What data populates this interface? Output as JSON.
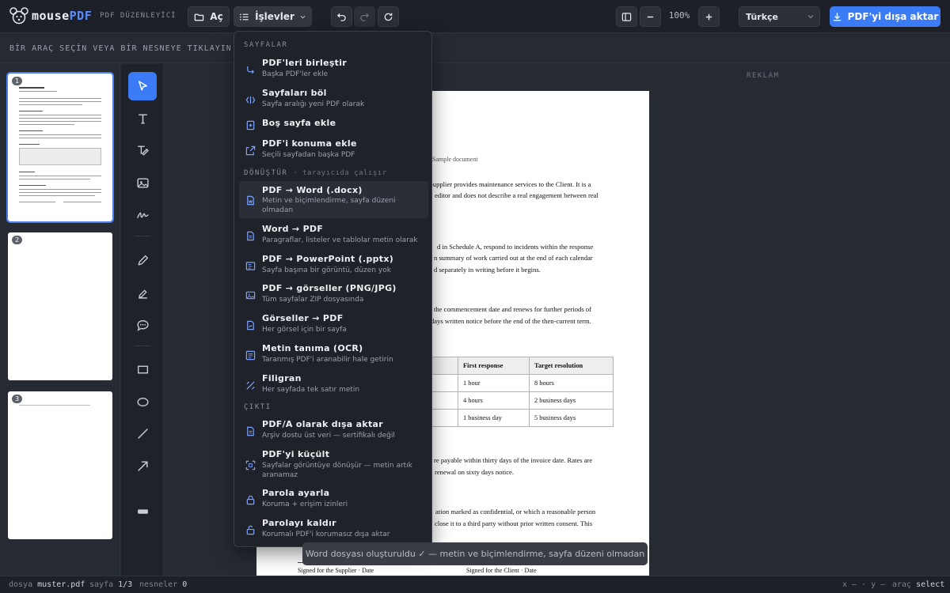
{
  "app": {
    "name_part1": "mouse",
    "name_part2": "PDF",
    "subtitle": "PDF DÜZENLEYİCİ",
    "logo_icon": "mouse-logo-icon"
  },
  "toolbar": {
    "open_label": "Aç",
    "functions_label": "İşlevler",
    "zoom": "100%",
    "language": "Türkçe",
    "export_label": "PDF'yi dışa aktar"
  },
  "hint": "BİR ARAÇ SEÇİN VEYA BİR NESNEYE TIKLAYIN — BAĞLA",
  "ad_label": "REKLAM",
  "thumbnails": [
    {
      "num": "1"
    },
    {
      "num": "2"
    },
    {
      "num": "3"
    }
  ],
  "tools": [
    "select-tool",
    "text-tool",
    "edit-text-tool",
    "image-tool",
    "signature-tool",
    "pencil-tool",
    "highlighter-tool",
    "comment-tool",
    "rectangle-tool",
    "ellipse-tool",
    "line-tool",
    "arrow-tool",
    "redact-tool"
  ],
  "menu": {
    "sections": {
      "pages": "SAYFALAR",
      "convert": "DÖNÜŞTÜR",
      "convert_note": "· tarayıcıda çalışır",
      "output": "ÇIKTI"
    },
    "items": [
      {
        "title": "PDF'leri birleştir",
        "desc": "Başka PDF'ler ekle",
        "icon": "merge-icon"
      },
      {
        "title": "Sayfaları böl",
        "desc": "Sayfa aralığı yeni PDF olarak",
        "icon": "split-icon"
      },
      {
        "title": "Boş sayfa ekle",
        "desc": "",
        "icon": "blank-page-icon"
      },
      {
        "title": "PDF'i konuma ekle",
        "desc": "Seçili sayfadan başka PDF",
        "icon": "insert-pdf-icon"
      },
      {
        "title": "PDF → Word (.docx)",
        "desc": "Metin ve biçimlendirme, sayfa düzeni olmadan",
        "icon": "word-doc-icon"
      },
      {
        "title": "Word → PDF",
        "desc": "Paragraflar, listeler ve tablolar metin olarak",
        "icon": "pdf-doc-icon"
      },
      {
        "title": "PDF → PowerPoint (.pptx)",
        "desc": "Sayfa başına bir görüntü, düzen yok",
        "icon": "slides-icon"
      },
      {
        "title": "PDF → görseller (PNG/JPG)",
        "desc": "Tüm sayfalar ZIP dosyasında",
        "icon": "image-export-icon"
      },
      {
        "title": "Görseller → PDF",
        "desc": "Her görsel için bir sayfa",
        "icon": "image-to-pdf-icon"
      },
      {
        "title": "Metin tanıma (OCR)",
        "desc": "Taranmış PDF'i aranabilir hale getirin",
        "icon": "ocr-icon"
      },
      {
        "title": "Filigran",
        "desc": "Her sayfada tek satır metin",
        "icon": "watermark-icon"
      },
      {
        "title": "PDF/A olarak dışa aktar",
        "desc": "Arşiv dostu üst veri — sertifikalı değil",
        "icon": "archive-icon"
      },
      {
        "title": "PDF'yi küçült",
        "desc": "Sayfalar görüntüye dönüşür — metin artık aranamaz",
        "icon": "compress-icon"
      },
      {
        "title": "Parola ayarla",
        "desc": "Koruma + erişim izinleri",
        "icon": "lock-icon"
      },
      {
        "title": "Parolayı kaldır",
        "desc": "Korumalı PDF'i korumasız dışa aktar",
        "icon": "unlock-icon"
      }
    ]
  },
  "document": {
    "header_note": "Sample document",
    "lines": [
      "Supplier provides maintenance services to the Client. It is a",
      "editor and does not describe a real engagement between real",
      "d in Schedule A, respond to incidents within the response",
      "n summary of work carried out at the end of each calendar",
      "d separately in writing before it begins.",
      "the commencement date and renews for further periods of",
      "days written notice before the end of the then-current term.",
      "re payable within thirty days of the invoice date. Rates are",
      "renewal on sixty days notice.",
      "ation marked as confidential, or which a reasonable person",
      "close it to a third party without prior written consent. This"
    ],
    "table": {
      "headers": [
        "First response",
        "Target resolution"
      ],
      "rows": [
        [
          "1 hour",
          "8 hours"
        ],
        [
          "4 hours",
          "2 business days"
        ],
        [
          "1 business day",
          "5 business days"
        ]
      ]
    },
    "sign_supplier": "Signed for the Supplier · Date",
    "sign_client": "Signed for the Client · Date"
  },
  "toast": "Word dosyası oluşturuldu ✓ — metin ve biçimlendirme, sayfa düzeni olmadan",
  "status": {
    "file_label": "dosya",
    "file_value": "muster.pdf",
    "page_label": "sayfa",
    "page_value": "1/3",
    "objects_label": "nesneler",
    "objects_value": "0",
    "coords": "x — · y —",
    "tool_label": "araç",
    "tool_value": "select"
  }
}
